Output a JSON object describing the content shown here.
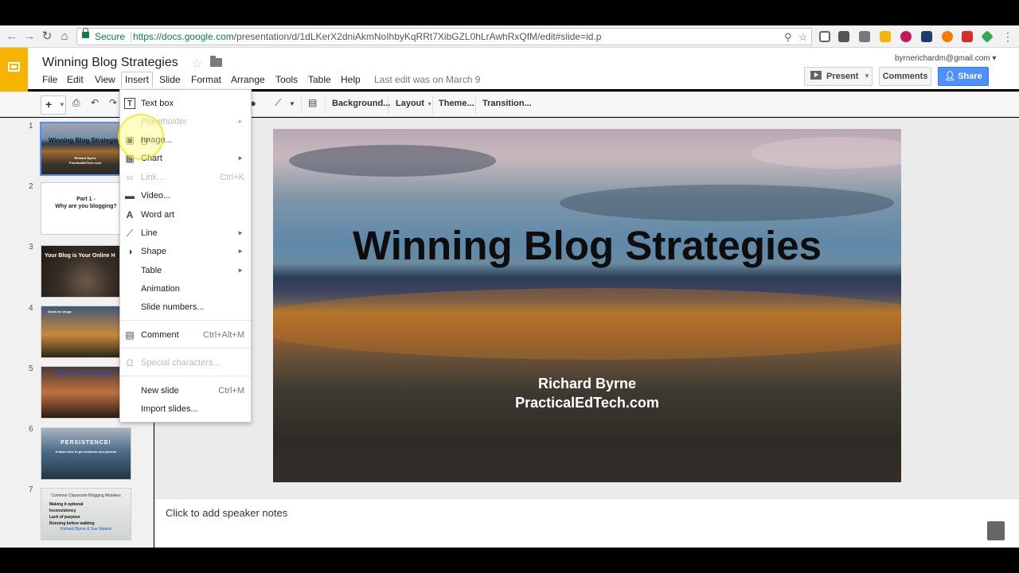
{
  "browser": {
    "secure_label": "Secure",
    "url_host": "https://docs.google.com",
    "url_path": "/presentation/d/1dLKerX2dniAkmNoIhbyKqRRt7XibGZL0hLrAwhRxQfM/edit#slide=id.p"
  },
  "app": {
    "title": "Winning Blog Strategies",
    "account": "byrnerichardm@gmail.com",
    "last_edit": "Last edit was on March 9",
    "menus": [
      "File",
      "Edit",
      "View",
      "Insert",
      "Slide",
      "Format",
      "Arrange",
      "Tools",
      "Table",
      "Help"
    ],
    "present_label": "Present",
    "comments_label": "Comments",
    "share_label": "Share"
  },
  "toolbar": {
    "background": "Background...",
    "layout": "Layout",
    "theme": "Theme...",
    "transition": "Transition..."
  },
  "insert_menu": {
    "text_box": "Text box",
    "placeholder": "Placeholder",
    "image": "Image...",
    "chart": "Chart",
    "link": "Link...",
    "link_shortcut": "Ctrl+K",
    "video": "Video...",
    "word_art": "Word art",
    "line": "Line",
    "shape": "Shape",
    "table": "Table",
    "animation": "Animation",
    "slide_numbers": "Slide numbers...",
    "comment": "Comment",
    "comment_shortcut": "Ctrl+Alt+M",
    "special_characters": "Special characters...",
    "new_slide": "New slide",
    "new_slide_shortcut": "Ctrl+M",
    "import_slides": "Import slides..."
  },
  "slides": [
    {
      "num": "1",
      "text": "Winning Blog Strategies",
      "sub1": "Richard Byrne",
      "sub2": "PracticalEdTech.com"
    },
    {
      "num": "2",
      "text": "Part 1 -",
      "sub1": "Why are you blogging?"
    },
    {
      "num": "3",
      "text": "Your Blog is Your Online H"
    },
    {
      "num": "4",
      "text": "Goals for blogs:"
    },
    {
      "num": "5",
      "text": "Who is your audience?"
    },
    {
      "num": "6",
      "text": "PERSISTENCE!",
      "sub1": "It takes time to get students and parents"
    },
    {
      "num": "7",
      "text": "Common Classroom Blogging Mistakes",
      "items": [
        "Making it optional",
        "Inconsistency",
        "Lack of purpose",
        "Running before walking"
      ],
      "credit_a": "Richard Byrne",
      "credit_b": "Sue Waters"
    }
  ],
  "current_slide": {
    "title": "Winning Blog Strategies",
    "author": "Richard Byrne",
    "site": "PracticalEdTech.com"
  },
  "notes_placeholder": "Click to add speaker notes",
  "colors": {
    "share_blue": "#4d90fe",
    "slides_yellow": "#f4b400",
    "secure_green": "#0b8043"
  }
}
